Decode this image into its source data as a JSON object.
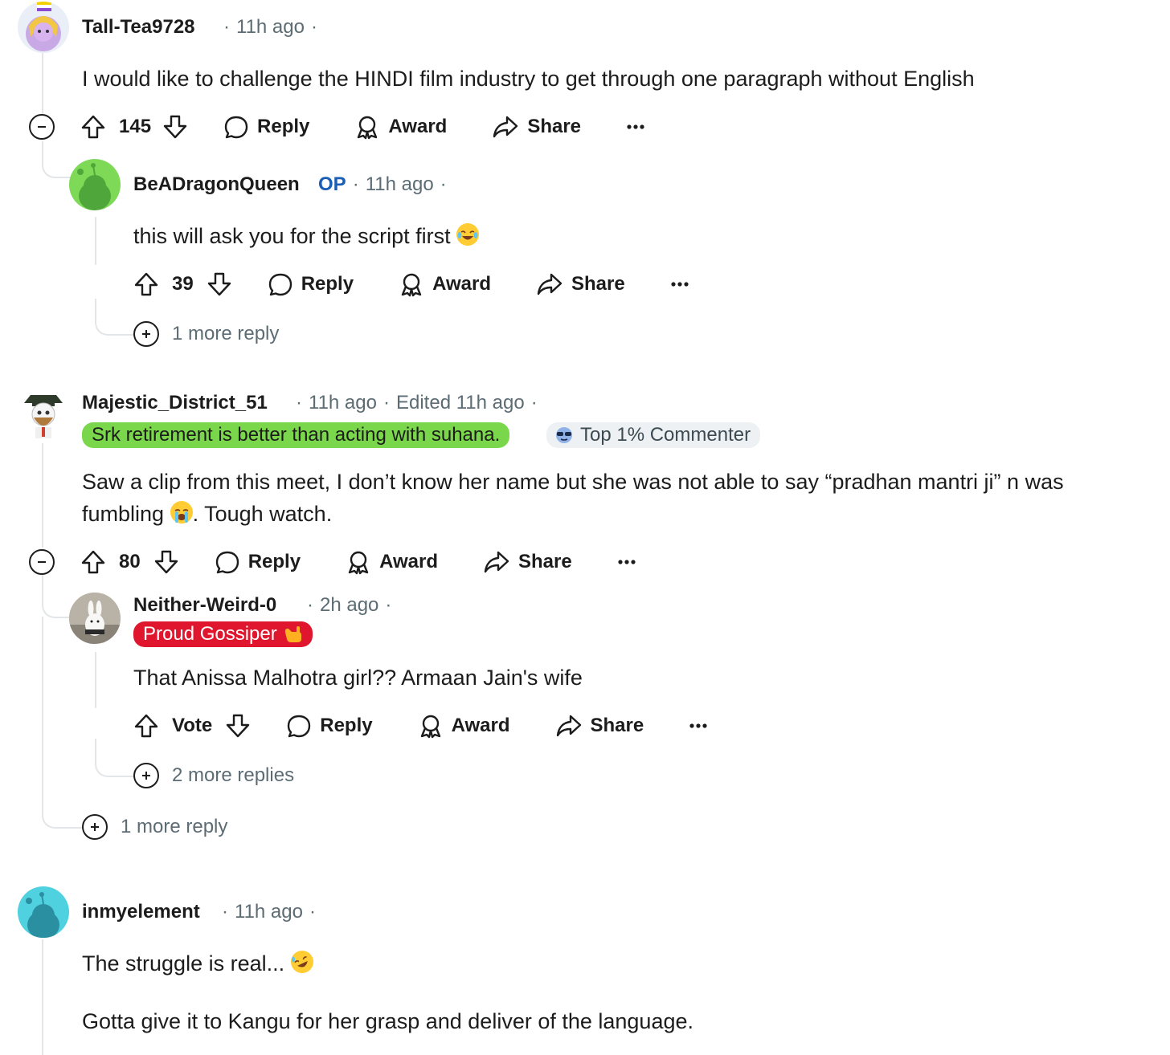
{
  "comments": [
    {
      "username": "Tall-Tea9728",
      "time": "11h ago",
      "body": "I would like to challenge the HINDI film industry to get through one paragraph without English",
      "score": "145"
    },
    {
      "username": "BeADragonQueen",
      "op_label": "OP",
      "time": "11h ago",
      "body": "this will ask you for the script first",
      "score": "39",
      "more_replies": "1 more reply"
    },
    {
      "username": "Majestic_District_51",
      "time": "11h ago",
      "edited": "Edited 11h ago",
      "flair": "Srk retirement is better than acting with suhana.",
      "badge": "Top 1% Commenter",
      "body_line1": "Saw a clip from this meet, I don’t know her name but she was not able to say “pradhan mantri ji” n was",
      "body_line2a": "fumbling",
      "body_line2b": ". Tough watch.",
      "score": "80",
      "more_replies": "1 more reply"
    },
    {
      "username": "Neither-Weird-0",
      "time": "2h ago",
      "flair": "Proud Gossiper",
      "body": "That Anissa Malhotra girl?? Armaan Jain's wife",
      "score": "Vote",
      "more_replies": "2 more replies"
    },
    {
      "username": "inmyelement",
      "time": "11h ago",
      "body_line1": "The struggle is real...",
      "body_line2": "Gotta give it to Kangu for her grasp and deliver of the language."
    }
  ],
  "actions": {
    "reply": "Reply",
    "award": "Award",
    "share": "Share"
  },
  "colors": {
    "flair_green": "#7ad74b",
    "flair_red": "#e0162e",
    "op_blue": "#1a5db4",
    "meta_grey": "#5c6c74",
    "thread_line": "#e3e6e8"
  }
}
